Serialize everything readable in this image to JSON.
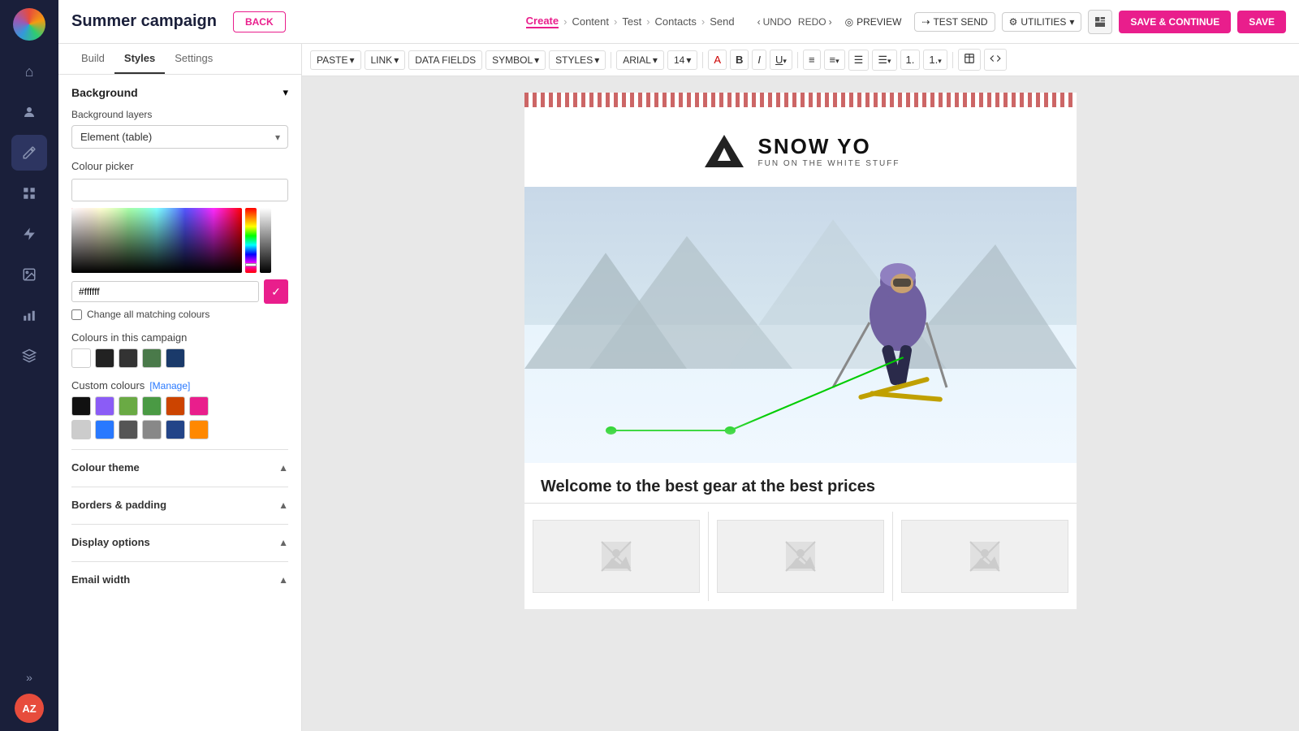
{
  "app": {
    "logo_text": "AZ",
    "campaign_title": "Summer campaign"
  },
  "topbar": {
    "back_label": "BACK",
    "breadcrumb": {
      "create": "Create",
      "content": "Content",
      "test": "Test",
      "contacts": "Contacts",
      "send": "Send"
    },
    "undo_label": "UNDO",
    "redo_label": "REDO",
    "preview_label": "PREVIEW",
    "test_send_label": "TEST SEND",
    "utilities_label": "UTILITIES",
    "save_continue_label": "SAVE & CONTINUE",
    "save_label": "SAVE"
  },
  "toolbar": {
    "paste_label": "PASTE",
    "link_label": "LINK",
    "data_fields_label": "DATA FIELDS",
    "symbol_label": "SYMBOL",
    "styles_label": "STYLES",
    "font_label": "ARIAL",
    "size_label": "14"
  },
  "panel": {
    "tabs": {
      "build": "Build",
      "styles": "Styles",
      "settings": "Settings"
    },
    "background_section": "Background",
    "background_layers_label": "Background layers",
    "background_layers_value": "Element (table)",
    "colour_picker_label": "Colour picker",
    "hex_value": "#ffffff",
    "change_all_colours_label": "Change all matching colours",
    "colours_in_campaign_label": "Colours in this campaign",
    "campaign_colours": [
      {
        "hex": "#ffffff",
        "name": "white"
      },
      {
        "hex": "#222222",
        "name": "dark-gray"
      },
      {
        "hex": "#333333",
        "name": "near-black"
      },
      {
        "hex": "#4a7a4a",
        "name": "green"
      },
      {
        "hex": "#1a3a6a",
        "name": "navy"
      }
    ],
    "custom_colours_label": "Custom colours",
    "manage_label": "[Manage]",
    "custom_colours": [
      {
        "hex": "#111111",
        "name": "black"
      },
      {
        "hex": "#8b5cf6",
        "name": "purple"
      },
      {
        "hex": "#6aaa44",
        "name": "green-1"
      },
      {
        "hex": "#4a9a44",
        "name": "green-2"
      },
      {
        "hex": "#cc4400",
        "name": "orange-dark"
      },
      {
        "hex": "#e91e8c",
        "name": "pink"
      },
      {
        "hex": "#cccccc",
        "name": "light-gray"
      },
      {
        "hex": "#2979ff",
        "name": "blue"
      },
      {
        "hex": "#555555",
        "name": "mid-gray"
      },
      {
        "hex": "#888888",
        "name": "gray"
      },
      {
        "hex": "#224488",
        "name": "dark-blue"
      },
      {
        "hex": "#ff8800",
        "name": "orange"
      }
    ],
    "colour_theme_label": "Colour theme",
    "borders_padding_label": "Borders & padding",
    "display_options_label": "Display options",
    "email_width_label": "Email width"
  },
  "email": {
    "logo_name": "SNOW YO",
    "logo_sub": "FUN ON THE WHITE STUFF",
    "welcome_text": "Welcome to the best gear at the best prices"
  },
  "sidebar_icons": [
    {
      "name": "home-icon",
      "symbol": "⌂"
    },
    {
      "name": "users-icon",
      "symbol": "👤"
    },
    {
      "name": "edit-icon",
      "symbol": "✎"
    },
    {
      "name": "grid-icon",
      "symbol": "▦"
    },
    {
      "name": "lightning-icon",
      "symbol": "⚡"
    },
    {
      "name": "image-icon",
      "symbol": "🖼"
    },
    {
      "name": "chart-icon",
      "symbol": "📊"
    },
    {
      "name": "layers-icon",
      "symbol": "▣"
    }
  ]
}
